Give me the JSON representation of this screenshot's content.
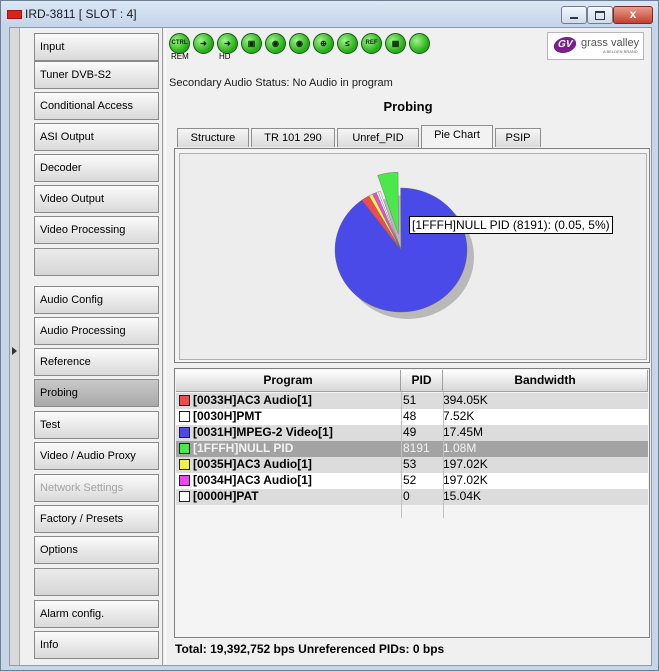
{
  "window": {
    "title": "IRD-3811 [ SLOT : 4]",
    "close_glyph": "x"
  },
  "nav": {
    "items": [
      {
        "label": "Input",
        "state": "normal"
      },
      {
        "label": "Tuner DVB-S2",
        "state": "normal"
      },
      {
        "label": "Conditional Access",
        "state": "normal"
      },
      {
        "label": "ASI Output",
        "state": "normal"
      },
      {
        "label": "Decoder",
        "state": "normal"
      },
      {
        "label": "Video Output",
        "state": "normal"
      },
      {
        "label": "Video Processing",
        "state": "normal"
      },
      {
        "label": "",
        "state": "empty"
      },
      {
        "label": "Audio Config",
        "state": "normal"
      },
      {
        "label": "Audio Processing",
        "state": "normal"
      },
      {
        "label": "Reference",
        "state": "normal"
      },
      {
        "label": "Probing",
        "state": "active"
      },
      {
        "label": "Test",
        "state": "normal"
      },
      {
        "label": "Video / Audio Proxy",
        "state": "normal"
      },
      {
        "label": "Network Settings",
        "state": "disabled"
      },
      {
        "label": "Factory / Presets",
        "state": "normal"
      },
      {
        "label": "Options",
        "state": "normal"
      },
      {
        "label": "",
        "state": "empty"
      },
      {
        "label": "Alarm config.",
        "state": "normal"
      },
      {
        "label": "Info",
        "state": "normal"
      }
    ]
  },
  "status_icons": [
    {
      "name": "ctrl-icon",
      "glyph": "CTRL",
      "label": "REM"
    },
    {
      "name": "input-arrow-icon",
      "glyph": "➜",
      "label": ""
    },
    {
      "name": "hd-arrow-icon",
      "glyph": "➜",
      "label": "HD"
    },
    {
      "name": "video-icon",
      "glyph": "▣",
      "label": ""
    },
    {
      "name": "audio-1-icon",
      "glyph": "◉",
      "label": ""
    },
    {
      "name": "audio-2-icon",
      "glyph": "◉",
      "label": ""
    },
    {
      "name": "lock-icon",
      "glyph": "⊕",
      "label": ""
    },
    {
      "name": "less-equal-icon",
      "glyph": "≤",
      "label": ""
    },
    {
      "name": "ref-icon",
      "glyph": "REF",
      "label": ""
    },
    {
      "name": "test-pattern-icon",
      "glyph": "▦",
      "label": ""
    },
    {
      "name": "status-ok-icon",
      "glyph": "",
      "label": ""
    }
  ],
  "logo": {
    "mark": "GV",
    "name": "grass valley",
    "sub": "A BELDEN BRAND"
  },
  "secondary_audio_status": "Secondary Audio Status: No Audio in program",
  "section_title": "Probing",
  "tabs": [
    {
      "label": "Structure",
      "selected": false
    },
    {
      "label": "TR 101 290",
      "selected": false
    },
    {
      "label": "Unref_PID",
      "selected": false
    },
    {
      "label": "Pie Chart",
      "selected": true
    },
    {
      "label": "PSIP",
      "selected": false
    }
  ],
  "tooltip": "[1FFFH]NULL PID (8191): (0.05, 5%)",
  "table": {
    "headers": {
      "program": "Program",
      "pid": "PID",
      "bandwidth": "Bandwidth"
    },
    "rows": [
      {
        "program": "[0033H]AC3 Audio[1]",
        "pid": "51",
        "bandwidth": "394.05K",
        "color": "#ef4b4b",
        "style": "grey"
      },
      {
        "program": "[0030H]PMT",
        "pid": "48",
        "bandwidth": "7.52K",
        "color": "#ffffff",
        "style": "white"
      },
      {
        "program": "[0031H]MPEG-2 Video[1]",
        "pid": "49",
        "bandwidth": "17.45M",
        "color": "#4a4ae8",
        "style": "grey"
      },
      {
        "program": "[1FFFH]NULL PID",
        "pid": "8191",
        "bandwidth": "1.08M",
        "color": "#4ae84a",
        "style": "sel"
      },
      {
        "program": "[0035H]AC3 Audio[1]",
        "pid": "53",
        "bandwidth": "197.02K",
        "color": "#f0f04a",
        "style": "grey"
      },
      {
        "program": "[0034H]AC3 Audio[1]",
        "pid": "52",
        "bandwidth": "197.02K",
        "color": "#e84ae8",
        "style": "white"
      },
      {
        "program": "[0000H]PAT",
        "pid": "0",
        "bandwidth": "15.04K",
        "color": "#ffffff",
        "style": "grey"
      }
    ]
  },
  "pie": {
    "slices": [
      {
        "pid": "8191",
        "fraction": 0.05,
        "color": "#4ae84a",
        "exploded": true
      },
      {
        "pid": "49",
        "fraction": 0.9,
        "color": "#4a4ae8",
        "exploded": false
      },
      {
        "pid": "51",
        "fraction": 0.02,
        "color": "#ef4b4b",
        "exploded": false
      },
      {
        "pid": "53",
        "fraction": 0.01,
        "color": "#f0f04a",
        "exploded": false
      },
      {
        "pid": "52",
        "fraction": 0.01,
        "color": "#e84ae8",
        "exploded": false
      },
      {
        "pid": "48",
        "fraction": 0.005,
        "color": "#ffffff",
        "exploded": false
      },
      {
        "pid": "0",
        "fraction": 0.005,
        "color": "#ffffff",
        "exploded": false
      }
    ]
  },
  "totals": "Total: 19,392,752 bps   Unreferenced PIDs: 0 bps"
}
